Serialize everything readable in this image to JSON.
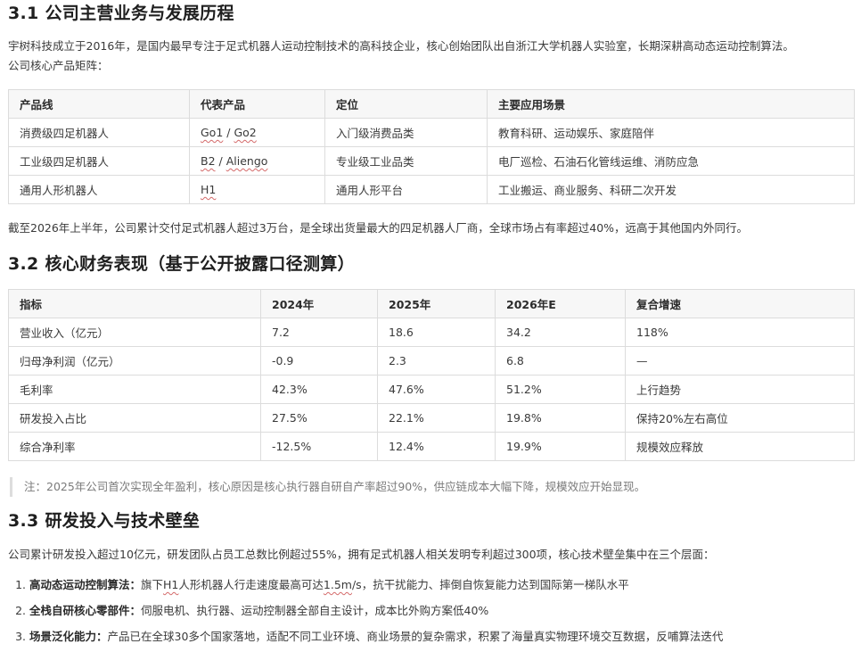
{
  "s1": {
    "heading": "3.1 公司主营业务与发展历程",
    "intro_1": "宇树科技成立于2016年，是国内最早专注于足式机器人运动控制技术的高科技企业，核心创始团队出自浙江大学机器人实验室，长期深耕高动态运动控制算法。",
    "intro_2": "公司核心产品矩阵：",
    "table": {
      "headers": [
        "产品线",
        "代表产品",
        "定位",
        "主要应用场景"
      ],
      "rows": [
        {
          "line": "消费级四足机器人",
          "p1": "Go1",
          "sep": " / ",
          "p2": "Go2",
          "pos": "入门级消费品类",
          "scene": "教育科研、运动娱乐、家庭陪伴"
        },
        {
          "line": "工业级四足机器人",
          "p1": "B2",
          "sep": " / ",
          "p2": "Aliengo",
          "pos": "专业级工业品类",
          "scene": "电厂巡检、石油石化管线运维、消防应急"
        },
        {
          "line": "通用人形机器人",
          "p1": "H1",
          "sep": "",
          "p2": "",
          "pos": "通用人形平台",
          "scene": "工业搬运、商业服务、科研二次开发"
        }
      ]
    },
    "after": "截至2026年上半年，公司累计交付足式机器人超过3万台，是全球出货量最大的四足机器人厂商，全球市场占有率超过40%，远高于其他国内外同行。"
  },
  "s2": {
    "heading": "3.2 核心财务表现（基于公开披露口径测算）",
    "table": {
      "headers": [
        "指标",
        "2024年",
        "2025年",
        "2026年E",
        "复合增速"
      ],
      "rows": [
        [
          "营业收入（亿元）",
          "7.2",
          "18.6",
          "34.2",
          "118%"
        ],
        [
          "归母净利润（亿元）",
          "-0.9",
          "2.3",
          "6.8",
          "—"
        ],
        [
          "毛利率",
          "42.3%",
          "47.6%",
          "51.2%",
          "上行趋势"
        ],
        [
          "研发投入占比",
          "27.5%",
          "22.1%",
          "19.8%",
          "保持20%左右高位"
        ],
        [
          "综合净利率",
          "-12.5%",
          "12.4%",
          "19.9%",
          "规模效应释放"
        ]
      ]
    },
    "note": "注：2025年公司首次实现全年盈利，核心原因是核心执行器自研自产率超过90%，供应链成本大幅下降，规模效应开始显现。"
  },
  "s3": {
    "heading": "3.3 研发投入与技术壁垒",
    "intro": "公司累计研发投入超过10亿元，研发团队占员工总数比例超过55%，拥有足式机器人相关发明专利超过300项，核心技术壁垒集中在三个层面：",
    "items": [
      {
        "title": "高动态运动控制算法：",
        "t1": "旗下",
        "w1": "H1",
        "t2": "人形机器人行走速度最高可达",
        "w2": "1.5m",
        "t3": "/s，抗干扰能力、摔倒自恢复能力达到国际第一梯队水平"
      },
      {
        "title": "全栈自研核心零部件：",
        "t1": "伺服电机、执行器、运动控制器全部自主设计，成本比外购方案低40%",
        "w1": "",
        "t2": "",
        "w2": "",
        "t3": ""
      },
      {
        "title": "场景泛化能力：",
        "t1": "产品已在全球30多个国家落地，适配不同工业环境、商业场景的复杂需求，积累了海量真实物理环境交互数据，反哺算法迭代",
        "w1": "",
        "t2": "",
        "w2": "",
        "t3": ""
      }
    ]
  }
}
